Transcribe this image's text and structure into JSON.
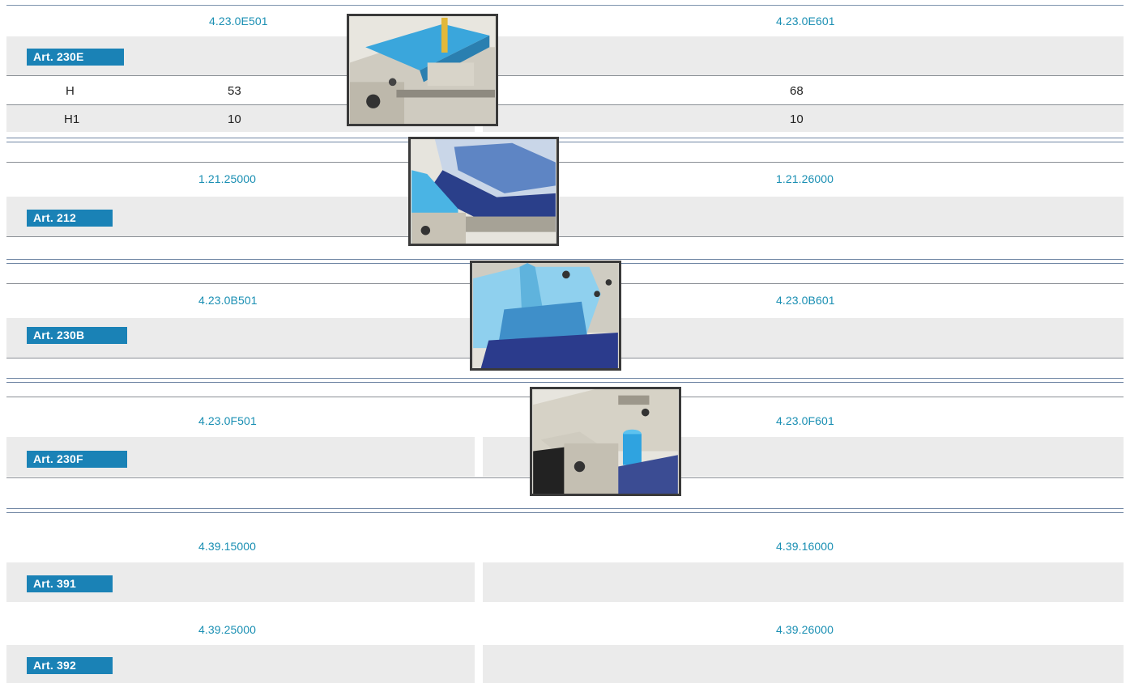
{
  "sections": [
    {
      "article": "Art. 230E",
      "codes": [
        "4.23.0E501",
        "4.23.0E601"
      ],
      "dimensions": [
        {
          "label": "H",
          "left": "53",
          "right": "68"
        },
        {
          "label": "H1",
          "left": "10",
          "right": "10"
        }
      ],
      "photo_icon": "vice-jaw-with-blue-plate-and-yellow-pin"
    },
    {
      "article": "Art. 212",
      "codes": [
        "1.21.25000",
        "1.21.26000"
      ],
      "photo_icon": "vice-jaw-with-blue-stepped-block"
    },
    {
      "article": "Art. 230B",
      "codes": [
        "4.23.0B501",
        "4.23.0B601"
      ],
      "photo_icon": "vice-jaw-with-blue-profiled-jaw"
    },
    {
      "article": "Art. 230F",
      "codes": [
        "4.23.0F501",
        "4.23.0F601"
      ],
      "photo_icon": "vice-jaw-with-blue-cylinder-stop"
    },
    {
      "article": "Art. 391",
      "codes": [
        "4.39.15000",
        "4.39.16000"
      ]
    },
    {
      "article": "Art. 392",
      "codes": [
        "4.39.25000",
        "4.39.26000"
      ]
    }
  ],
  "colors": {
    "code_text": "#1a8fb3",
    "badge_bg": "#1a82b6",
    "band_bg": "#ebebeb",
    "rule": "#6f85a3"
  }
}
